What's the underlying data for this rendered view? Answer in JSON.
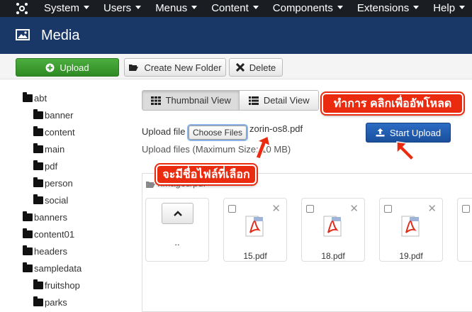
{
  "topbar": {
    "menu": [
      "System",
      "Users",
      "Menus",
      "Content",
      "Components",
      "Extensions",
      "Help"
    ]
  },
  "titlebar": {
    "title": "Media"
  },
  "toolbar": {
    "upload_label": "Upload",
    "new_folder_label": "Create New Folder",
    "delete_label": "Delete"
  },
  "tree": [
    {
      "label": "abt",
      "level": 0
    },
    {
      "label": "banner",
      "level": 1
    },
    {
      "label": "content",
      "level": 1
    },
    {
      "label": "main",
      "level": 1
    },
    {
      "label": "pdf",
      "level": 1
    },
    {
      "label": "person",
      "level": 1
    },
    {
      "label": "social",
      "level": 1
    },
    {
      "label": "banners",
      "level": 0
    },
    {
      "label": "content01",
      "level": 0
    },
    {
      "label": "headers",
      "level": 0
    },
    {
      "label": "sampledata",
      "level": 0
    },
    {
      "label": "fruitshop",
      "level": 1
    },
    {
      "label": "parks",
      "level": 1
    }
  ],
  "views": {
    "thumbnail_label": "Thumbnail View",
    "detail_label": "Detail View"
  },
  "upload": {
    "label": "Upload file",
    "choose_label": "Choose Files",
    "file_name": "zorin-os8.pdf",
    "max_size_text": "Upload files (Maximum Size: 10 MB)",
    "start_label": "Start Upload"
  },
  "files": {
    "breadcrumb": "/images/pdf",
    "up_label": "..",
    "items": [
      {
        "name": "15.pdf"
      },
      {
        "name": "18.pdf"
      },
      {
        "name": "19.pdf"
      }
    ]
  },
  "annotations": {
    "upload_note": "ทำการ คลิกเพื่ออัพโหลด",
    "name_note": "จะมีชื่อไฟล์ที่เลือก"
  },
  "colors": {
    "accent_red": "#ea2b10",
    "nav_dark": "#1a1d22",
    "title_blue": "#1a3867",
    "upload_green": "#3f9c33",
    "start_blue": "#2260b4"
  }
}
